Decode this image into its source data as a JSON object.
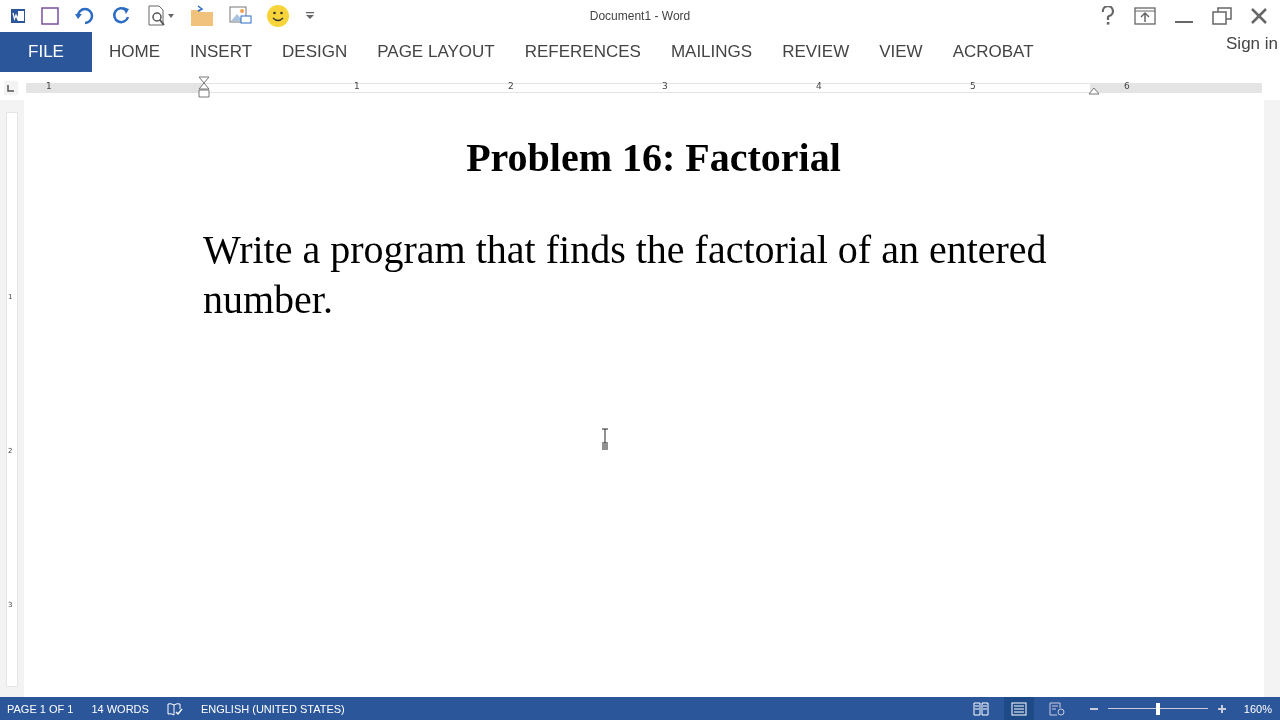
{
  "window": {
    "title": "Document1 - Word"
  },
  "tabs": [
    {
      "label": "FILE",
      "kind": "file",
      "selected": false
    },
    {
      "label": "HOME",
      "kind": "tab",
      "selected": false
    },
    {
      "label": "INSERT",
      "kind": "tab",
      "selected": false
    },
    {
      "label": "DESIGN",
      "kind": "tab",
      "selected": false
    },
    {
      "label": "PAGE LAYOUT",
      "kind": "tab",
      "selected": false
    },
    {
      "label": "REFERENCES",
      "kind": "tab",
      "selected": false
    },
    {
      "label": "MAILINGS",
      "kind": "tab",
      "selected": false
    },
    {
      "label": "REVIEW",
      "kind": "tab",
      "selected": false
    },
    {
      "label": "VIEW",
      "kind": "tab",
      "selected": false
    },
    {
      "label": "ACROBAT",
      "kind": "tab",
      "selected": false
    }
  ],
  "sign_in": "Sign in",
  "ruler": {
    "labels": [
      "1",
      "1",
      "2",
      "3",
      "4",
      "5",
      "6"
    ]
  },
  "vertical_ruler": {
    "labels": [
      "1",
      "2",
      "3"
    ]
  },
  "document": {
    "heading": "Problem 16: Factorial",
    "paragraph": "Write a program that finds the factorial of an entered number."
  },
  "status_bar": {
    "page": "PAGE 1 OF 1",
    "words": "14 WORDS",
    "language": "ENGLISH (UNITED STATES)",
    "views": [
      {
        "kind": "read",
        "selected": false
      },
      {
        "kind": "print",
        "selected": true
      },
      {
        "kind": "web",
        "selected": false
      }
    ],
    "zoom": {
      "level": 0.5,
      "reading": "160%"
    }
  }
}
